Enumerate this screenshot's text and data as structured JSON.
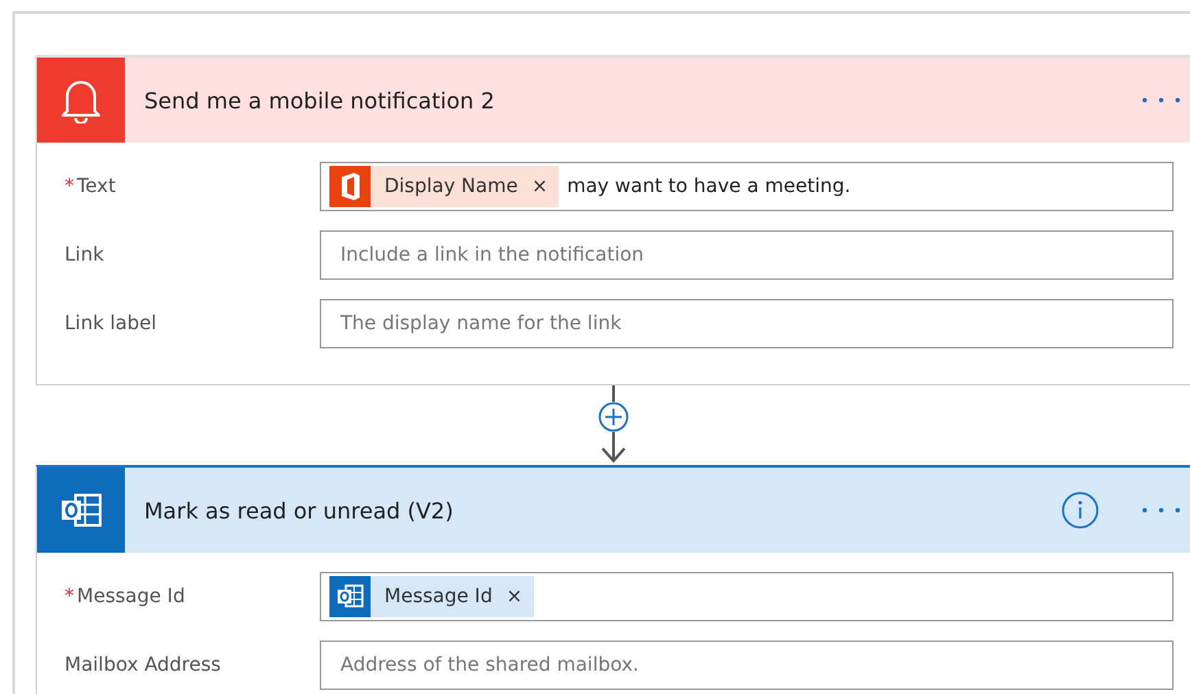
{
  "cards": [
    {
      "kind": "notification",
      "title": "Send me a mobile notification 2",
      "info": false,
      "fields": [
        {
          "label": "Text",
          "required_mark": "*",
          "tokens": [
            {
              "kind": "office",
              "label": "Display Name",
              "remove": "×"
            }
          ],
          "value": "may want to have a meeting."
        },
        {
          "label": "Link",
          "placeholder": "Include a link in the notification"
        },
        {
          "label": "Link label",
          "placeholder": "The display name for the link"
        }
      ]
    },
    {
      "kind": "outlook",
      "title": "Mark as read or unread (V2)",
      "info": true,
      "fields": [
        {
          "label": "Message Id",
          "required_mark": "*",
          "tokens": [
            {
              "kind": "outlook",
              "label": "Message Id",
              "remove": "×"
            }
          ]
        },
        {
          "label": "Mailbox Address",
          "placeholder": "Address of the shared mailbox."
        }
      ]
    }
  ]
}
